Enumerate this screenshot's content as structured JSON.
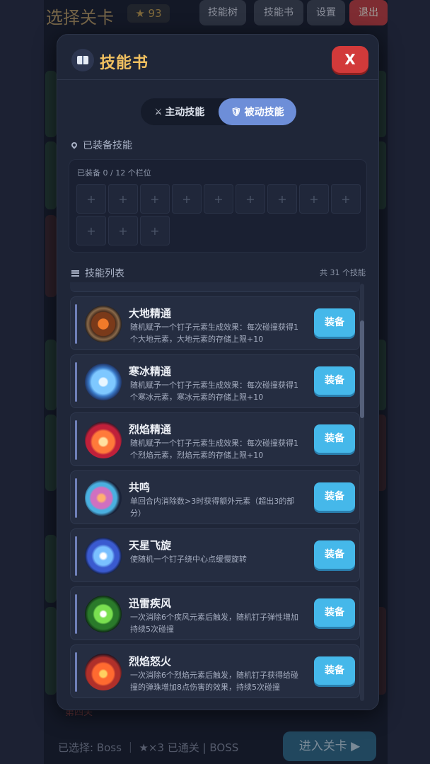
{
  "background": {
    "title": "选择关卡",
    "stars": "★ 93",
    "buttons": {
      "skill_tree": "技能树",
      "skill_book": "技能书",
      "settings": "设置",
      "exit": "退出"
    },
    "footer_selected": "已选择: Boss ｜ ★×3 已通关 | BOSS",
    "enter_button": "进入关卡 ▶",
    "stage_label": "第四关"
  },
  "modal": {
    "title": "技能书",
    "close_label": "X",
    "tabs": [
      {
        "label": "主动技能",
        "icon": "⚔",
        "active": false
      },
      {
        "label": "被动技能",
        "icon": "🛡",
        "active": true
      }
    ],
    "equipped_section": {
      "label": "已装备技能",
      "caption": "已装备 0 / 12 个栏位",
      "slot_symbol": "+",
      "slots_total": 12
    },
    "list_section": {
      "label": "技能列表",
      "count": "共 31 个技能"
    },
    "equip_label": "装备",
    "skills": [
      {
        "name": "大地精通",
        "icon": "earth-icon",
        "desc": "随机赋予一个钉子元素生成效果：每次碰撞获得1个大地元素，大地元素的存储上限+10"
      },
      {
        "name": "寒冰精通",
        "icon": "ice-icon",
        "desc": "随机赋予一个钉子元素生成效果：每次碰撞获得1个寒冰元素，寒冰元素的存储上限+10"
      },
      {
        "name": "烈焰精通",
        "icon": "fire-icon",
        "desc": "随机赋予一个钉子元素生成效果：每次碰撞获得1个烈焰元素，烈焰元素的存储上限+10"
      },
      {
        "name": "共鸣",
        "icon": "resonance-icon",
        "desc": "单回合内消除数>3时获得额外元素（超出3的部分）"
      },
      {
        "name": "天星飞旋",
        "icon": "star-icon",
        "desc": "使随机一个钉子绕中心点缓慢旋转"
      },
      {
        "name": "迅雷疾风",
        "icon": "thunder-icon",
        "desc": "一次消除6个疾风元素后触发，随机钉子弹性增加持续5次碰撞"
      },
      {
        "name": "烈焰怒火",
        "icon": "fury-icon",
        "desc": "一次消除6个烈焰元素后触发，随机钉子获得给碰撞的弹珠增加8点伤害的效果，持续5次碰撞"
      }
    ]
  },
  "colors": {
    "accent_gold": "#f0c060",
    "tab_active": "#6d8ed8",
    "equip_button": "#45b8ea",
    "close_button": "#d23a3a"
  }
}
